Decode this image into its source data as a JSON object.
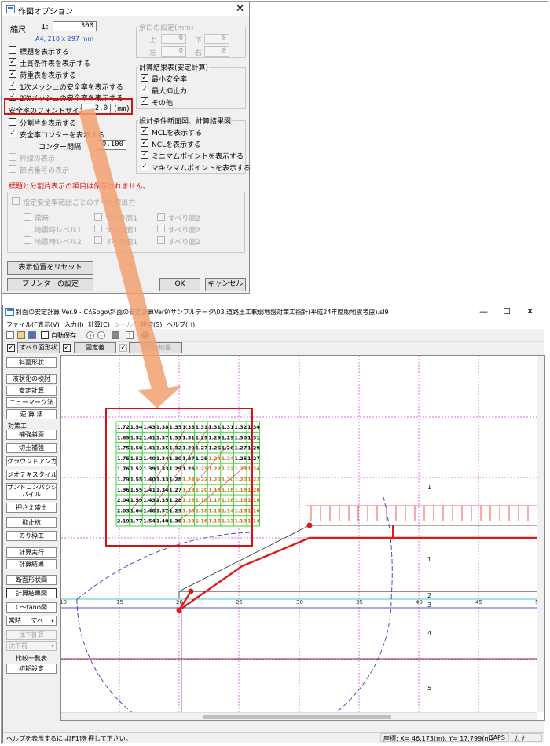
{
  "dialog": {
    "title": "作図オプション",
    "scale_label": "縮尺",
    "scale_prefix": "1:",
    "scale_value": "300",
    "paper": "A4, 210 x 297 mm",
    "margin_group": "余白の設定(mm)",
    "margin_top": "上",
    "margin_bottom": "下",
    "margin_left": "左",
    "margin_right": "右",
    "margin_values": {
      "top": "0",
      "bottom": "0",
      "left": "0",
      "right": "0"
    },
    "options": [
      {
        "label": "標題を表示する",
        "checked": false
      },
      {
        "label": "土質条件表を表示する",
        "checked": true
      },
      {
        "label": "荷重表を表示する",
        "checked": true
      },
      {
        "label": "1次メッシュの安全率を表示する",
        "checked": true
      },
      {
        "label": "2次メッシュの安全率を表示する",
        "checked": true
      }
    ],
    "font_size_label": "安全率のフォントサイズ",
    "font_size_value": "2.0",
    "font_size_unit": "(mm)",
    "split_label": "分割片を表示する",
    "contour_label": "安全率コンターを表示する",
    "contour_interval_label": "コンター間隔",
    "contour_interval_value": "0.100",
    "frame_label": "枠線の表示",
    "node_label": "節点番号の表示",
    "calc_group": "計算結果表(安定計算)",
    "calc_items": [
      "最小安全率",
      "最大抑止力",
      "その他"
    ],
    "design_group": "設計条件断面図、計算結果図",
    "design_items": [
      "MCLを表示する",
      "NCLを表示する",
      "ミニマムポイントを表示する",
      "マキシマムポイントを表示する"
    ],
    "warning": "標題と分割片表示の項目は保存されません。",
    "slip_group": "指定安全率範囲ごとのすべり線出力",
    "slip_rows": [
      [
        "常時",
        "すべり面1",
        "すべり面2"
      ],
      [
        "地震時レベル1",
        "すべり面1",
        "すべり面2"
      ],
      [
        "地震時レベル2",
        "すべり面1",
        "すべり面2"
      ]
    ],
    "btn_reset": "表示位置をリセット",
    "btn_printer": "プリンターの設定",
    "btn_ok": "OK",
    "btn_cancel": "キャンセル"
  },
  "app": {
    "title": "斜面の安定計算 Ver.9 - C:\\Sogo\\斜面の安定計算Ver9\\サンプルデータ\\03.道路土工軟弱地盤対策工指針(平成24年度版地震考慮).sl9",
    "win_min": "—",
    "win_max": "☐",
    "win_close": "✕",
    "menu": [
      "ファイル(F)",
      "表示(V)",
      "入力(I)",
      "計算(C)",
      "ツール(T)",
      "設定(S)",
      "ヘルプ(H)"
    ],
    "autosave": "自動保存",
    "slip_shape": "すべり面形状",
    "fixed_def": "固定義",
    "settle": "沈下後地盤",
    "sidebar": {
      "b1": "斜面形状",
      "b2": "液状化の検討",
      "b3": "安定計算",
      "b4": "ニューマーク法",
      "b5": "逆 算 法",
      "grp": "対策工",
      "b6": "補強斜面",
      "b7": "切土補強",
      "b8": "グラウンドアンカー",
      "b9": "ジオテキスタイル",
      "b10a": "サンドコンパクション",
      "b10b": "パイル",
      "b11": "押さえ盛土",
      "b12": "抑止杭",
      "b13": "のり枠工",
      "b14": "計算実行",
      "b15": "計算結果",
      "b16": "断面形状図",
      "b17": "計算結果図",
      "b18": "C〜tanφ図",
      "sel1a": "常時",
      "sel1b": "すべ",
      "b19": "沈下計算",
      "sel2": "沈下前",
      "b20": "比較一覧表",
      "b21": "初期設定"
    },
    "axis_ticks": [
      "10",
      "15",
      "20",
      "25",
      "30",
      "35",
      "40",
      "45",
      "5"
    ],
    "layer_labels": [
      "1",
      "1",
      "2",
      "3",
      "4",
      "5"
    ],
    "grid_values": [
      [
        "1.72",
        "1.54",
        "1.43",
        "1.38",
        "1.35",
        "1.33",
        "1.31",
        "1.31",
        "1.31",
        "1.32",
        "1.34"
      ],
      [
        "1.69",
        "1.52",
        "1.41",
        "1.37",
        "1.33",
        "1.31",
        "1.29",
        "1.29",
        "1.29",
        "1.30",
        "1.31"
      ],
      [
        "1.75",
        "1.50",
        "1.41",
        "1.35",
        "1.32",
        "1.29",
        "1.27",
        "1.26",
        "1.26",
        "1.27",
        "1.29"
      ],
      [
        "1.75",
        "1.52",
        "1.40",
        "1.34",
        "1.30",
        "1.27",
        "1.25",
        "1.24",
        "1.24",
        "1.25",
        "1.27"
      ],
      [
        "1.76",
        "1.52",
        "1.39",
        "1.33",
        "1.29",
        "1.26",
        "1.23",
        "1.22",
        "1.22",
        "1.23",
        "1.24"
      ],
      [
        "1.79",
        "1.55",
        "1.40",
        "1.33",
        "1.28",
        "1.24",
        "1.22",
        "1.20",
        "1.20",
        "1.20",
        "1.22"
      ],
      [
        "1.96",
        "1.55",
        "1.41",
        "1.34",
        "1.27",
        "1.23",
        "1.20",
        "1.18",
        "1.18",
        "1.18",
        "1.20"
      ],
      [
        "2.04",
        "1.59",
        "1.43",
        "1.35",
        "1.28",
        "1.23",
        "1.19",
        "1.17",
        "1.16",
        "1.16",
        "1.18"
      ],
      [
        "2.03",
        "1.64",
        "1.48",
        "1.37",
        "1.29",
        "1.23",
        "1.18",
        "1.16",
        "1.14",
        "1.15",
        "1.16"
      ],
      [
        "2.19",
        "1.77",
        "1.54",
        "1.40",
        "1.30",
        "1.23",
        "1.18",
        "1.15",
        "1.13",
        "1.13",
        "1.14"
      ]
    ],
    "status_help": "ヘルプを表示するには[F1]を押して下さい。",
    "status_coord": "座標: X= 46.173(m), Y= 17.799(m)",
    "status_caps": "CAPS",
    "status_kana": "カナ"
  }
}
